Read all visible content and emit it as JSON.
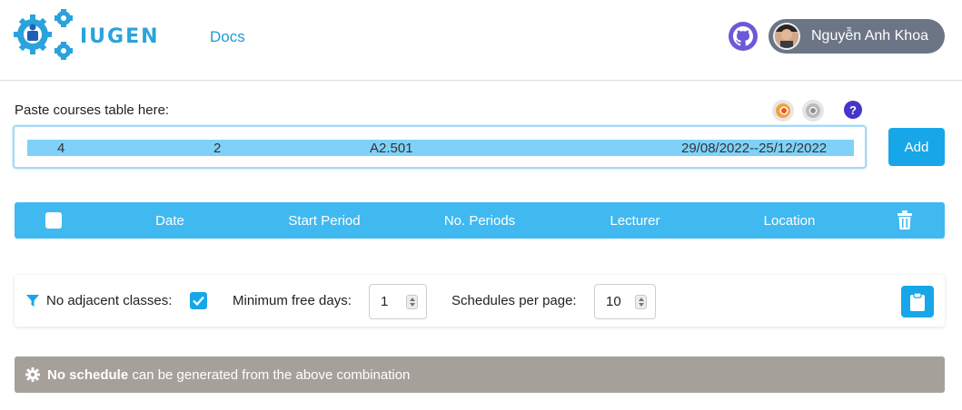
{
  "header": {
    "brand": "IUGEN",
    "nav_docs": "Docs",
    "user_name": "Nguyễn Anh Khoa",
    "icons": {
      "logo": "gears-logo-icon",
      "github": "github-icon",
      "avatar": "user-avatar"
    }
  },
  "paste": {
    "label": "Paste courses table here:",
    "row": [
      "4",
      "2",
      "A2.501",
      "29/08/2022--25/12/2022"
    ],
    "help": "?",
    "browser_icons": [
      "firefox-icon",
      "chrome-icon"
    ]
  },
  "add_button": "Add",
  "table": {
    "headers": [
      "Date",
      "Start Period",
      "No. Periods",
      "Lecturer",
      "Location"
    ],
    "icons": {
      "select_all": "checkbox",
      "delete": "trash-icon"
    }
  },
  "options": {
    "no_adjacent_label": "No adjacent classes:",
    "no_adjacent_checked": true,
    "min_free_days_label": "Minimum free days:",
    "min_free_days_value": "1",
    "schedules_per_page_label": "Schedules per page:",
    "schedules_per_page_value": "10",
    "icons": {
      "filter": "filter-icon",
      "clipboard": "clipboard-icon"
    }
  },
  "status": {
    "strong": "No schedule",
    "rest": " can be generated from the above combination",
    "icon": "gear-icon"
  },
  "colors": {
    "brand": "#2aa3dc",
    "primary": "#17a7e8",
    "table_header": "#40b9f1",
    "status_bg": "#a6a09a",
    "github": "#6a5ad8",
    "help": "#4536c8",
    "user_pill": "#6b7585"
  }
}
